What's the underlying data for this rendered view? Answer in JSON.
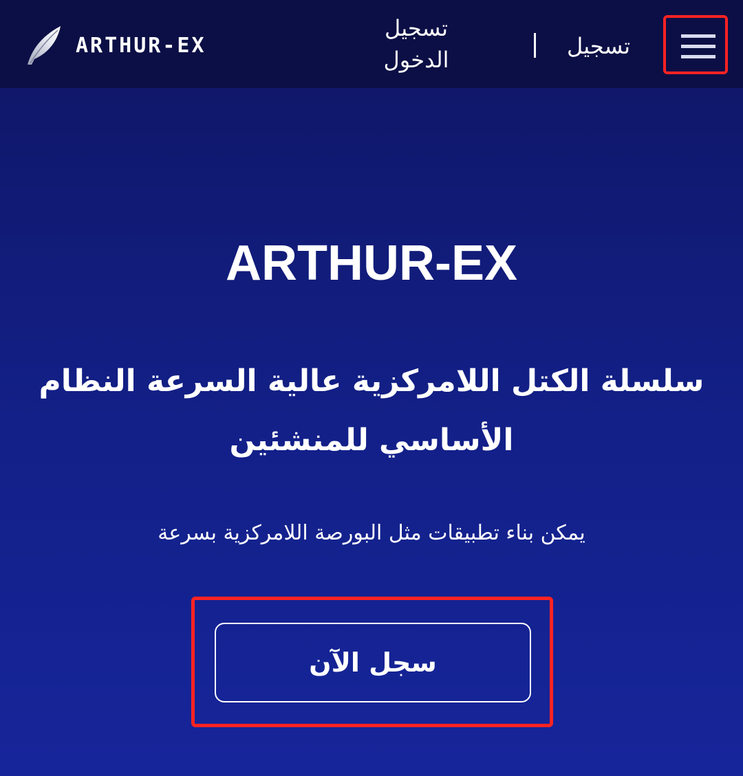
{
  "header": {
    "logo_text": "ARTHUR-EX",
    "login_label": "تسجيل الدخول",
    "register_label": "تسجيل",
    "menu_icon": "hamburger-menu-icon"
  },
  "hero": {
    "title": "ARTHUR-EX",
    "subtitle": "سلسلة الكتل اللامركزية عالية السرعة النظام الأساسي للمنشئين",
    "description": "يمكن بناء تطبيقات مثل البورصة اللامركزية بسرعة",
    "cta_label": "سجل الآن"
  },
  "colors": {
    "header_bg": "#0c0f45",
    "page_bg_top": "#0f1563",
    "page_bg_bottom": "#16259a",
    "highlight_border": "#ff2323",
    "text": "#ffffff"
  }
}
